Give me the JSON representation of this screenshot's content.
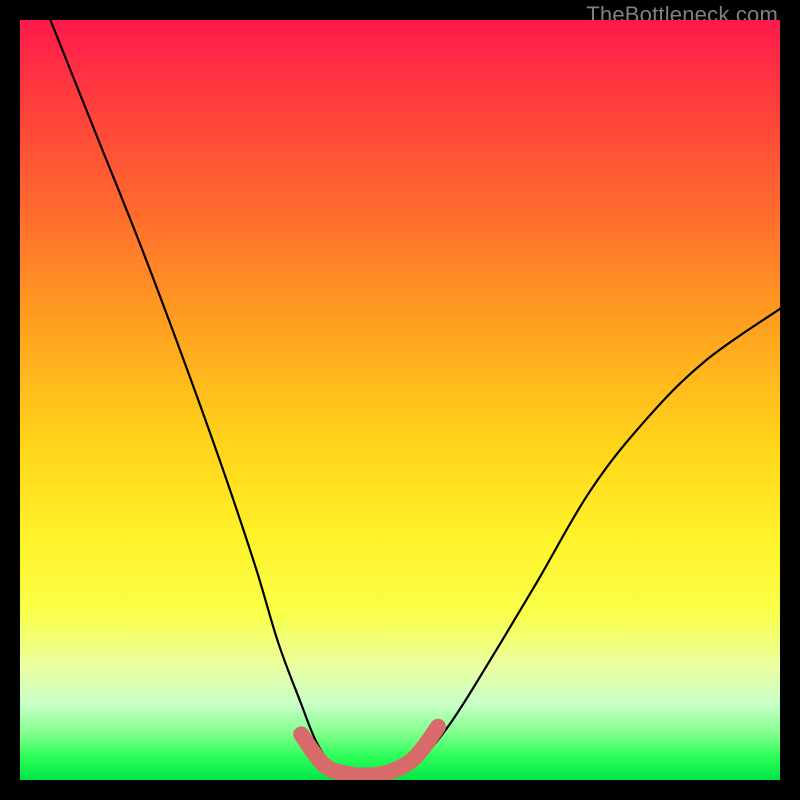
{
  "watermark": "TheBottleneck.com",
  "chart_data": {
    "type": "line",
    "title": "",
    "xlabel": "",
    "ylabel": "",
    "xlim": [
      0,
      100
    ],
    "ylim": [
      0,
      100
    ],
    "series": [
      {
        "name": "bottleneck-curve",
        "x": [
          4,
          10,
          16,
          22,
          27,
          31,
          34,
          37,
          39,
          41,
          43,
          45,
          47,
          50,
          53,
          57,
          62,
          68,
          75,
          82,
          90,
          100
        ],
        "values": [
          100,
          85,
          70,
          54,
          40,
          28,
          18,
          10,
          5,
          2,
          1,
          0.5,
          0.5,
          1,
          3,
          8,
          16,
          26,
          38,
          47,
          55,
          62
        ]
      },
      {
        "name": "optimal-band",
        "x": [
          37,
          40,
          43,
          46,
          49,
          52,
          55
        ],
        "values": [
          6,
          2,
          0.8,
          0.6,
          1.2,
          3,
          7
        ]
      }
    ],
    "colors": {
      "curve": "#000000",
      "optimal_band": "#d86a6a",
      "gradient_top": "#ff1a4d",
      "gradient_mid": "#ffe12a",
      "gradient_bottom": "#00e648"
    }
  }
}
